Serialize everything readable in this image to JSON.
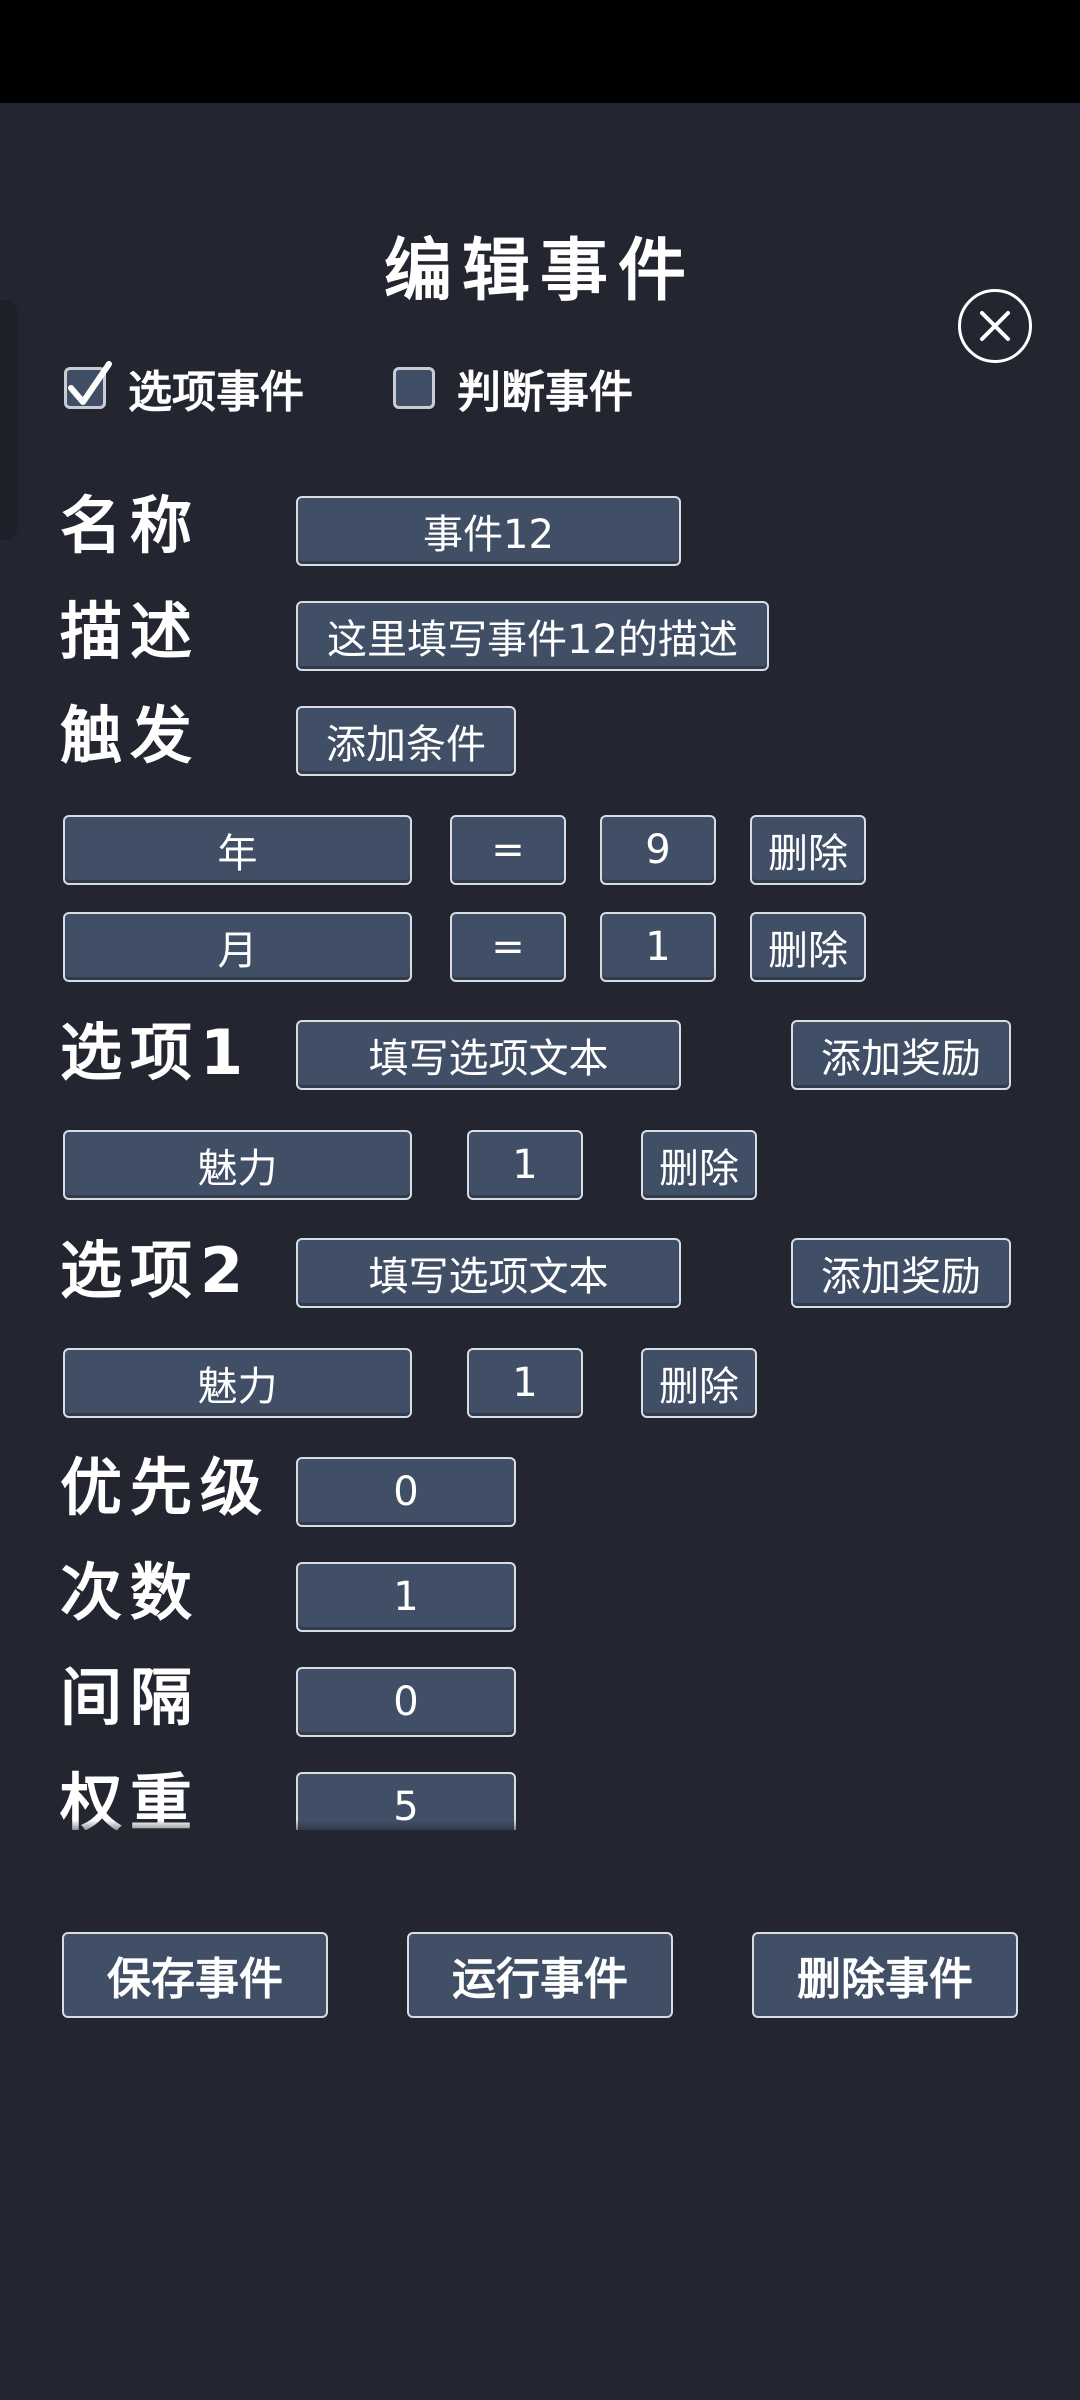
{
  "title": "编辑事件",
  "checkboxes": {
    "option_event": {
      "label": "选项事件",
      "checked": true
    },
    "judge_event": {
      "label": "判断事件",
      "checked": false
    }
  },
  "fields": {
    "name": {
      "label": "名称",
      "value": "事件12"
    },
    "description": {
      "label": "描述",
      "value": "这里填写事件12的描述"
    },
    "trigger": {
      "label": "触发",
      "button": "添加条件"
    }
  },
  "conditions": [
    {
      "variable": "年",
      "operator": "=",
      "value": "9",
      "delete": "删除"
    },
    {
      "variable": "月",
      "operator": "=",
      "value": "1",
      "delete": "删除"
    }
  ],
  "options": [
    {
      "label": "选项1",
      "text_placeholder": "填写选项文本",
      "add_reward": "添加奖励",
      "reward": {
        "attribute": "魅力",
        "amount": "1",
        "delete": "删除"
      }
    },
    {
      "label": "选项2",
      "text_placeholder": "填写选项文本",
      "add_reward": "添加奖励",
      "reward": {
        "attribute": "魅力",
        "amount": "1",
        "delete": "删除"
      }
    }
  ],
  "settings": {
    "priority": {
      "label": "优先级",
      "value": "0"
    },
    "count": {
      "label": "次数",
      "value": "1"
    },
    "interval": {
      "label": "间隔",
      "value": "0"
    },
    "weight": {
      "label": "权重",
      "value": "5"
    }
  },
  "actions": {
    "save": "保存事件",
    "run": "运行事件",
    "delete": "删除事件"
  },
  "colors": {
    "background": "#232631",
    "field": "#414f66",
    "border": "#d9dce3"
  },
  "icons": {
    "close": "close-icon",
    "check": "checkmark-icon"
  }
}
